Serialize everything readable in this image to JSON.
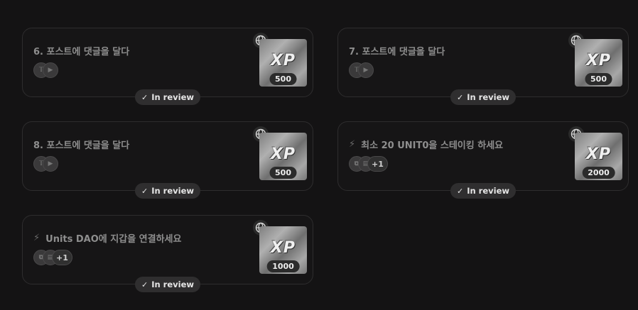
{
  "cards": [
    {
      "title": "6. 포스트에 댓글을 달다",
      "bolt": false,
      "chips": [
        "twitter-icon",
        "video-icon"
      ],
      "plus": "",
      "amount": "500",
      "status": "In review"
    },
    {
      "title": "7. 포스트에 댓글을 달다",
      "bolt": false,
      "chips": [
        "twitter-icon",
        "video-icon"
      ],
      "plus": "",
      "amount": "500",
      "status": "In review"
    },
    {
      "title": "8. 포스트에 댓글을 달다",
      "bolt": false,
      "chips": [
        "twitter-icon",
        "video-icon"
      ],
      "plus": "",
      "amount": "500",
      "status": "In review"
    },
    {
      "title": "최소 20 UNIT0을 스테이킹 하세요",
      "bolt": true,
      "chips": [
        "link-icon",
        "wallet-icon"
      ],
      "plus": "+1",
      "amount": "2000",
      "status": "In review"
    },
    {
      "title": "Units DAO에 지갑을 연결하세요",
      "bolt": true,
      "chips": [
        "link-icon",
        "wallet-icon"
      ],
      "plus": "+1",
      "amount": "1000",
      "status": "In review"
    }
  ],
  "xp_label": "XP",
  "colors": {
    "background": "#141314",
    "card_border": "#2e2d2e",
    "badge": "#2f2e2f"
  }
}
